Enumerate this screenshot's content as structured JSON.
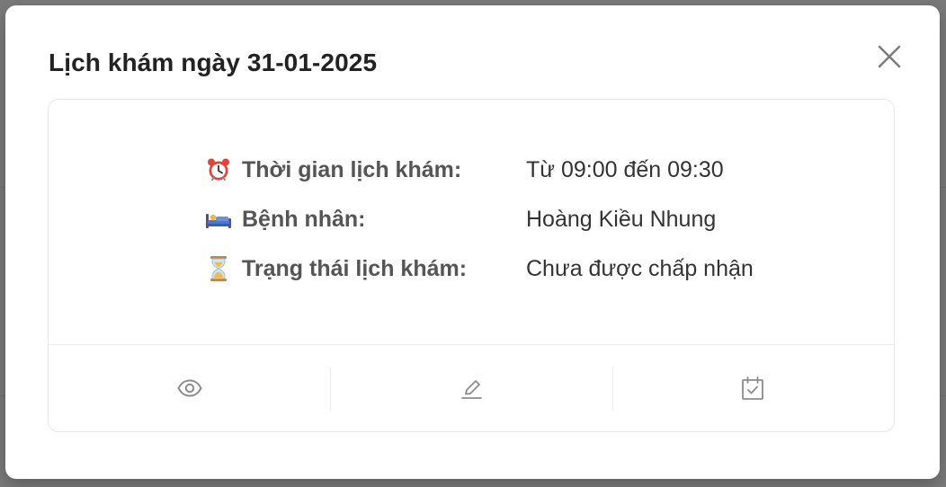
{
  "modal": {
    "title": "Lịch khám ngày 31-01-2025",
    "close_icon": "close-icon"
  },
  "appointment": {
    "rows": [
      {
        "icon": "alarm-clock-icon",
        "label": "Thời gian lịch khám:",
        "value": "Từ 09:00 đến 09:30"
      },
      {
        "icon": "bed-icon",
        "label": "Bệnh nhân:",
        "value": "Hoàng Kiều Nhung"
      },
      {
        "icon": "hourglass-icon",
        "label": "Trạng thái lịch khám:",
        "value": "Chưa được chấp nhận"
      }
    ]
  },
  "actions": [
    {
      "icon": "eye-icon"
    },
    {
      "icon": "edit-icon"
    },
    {
      "icon": "calendar-check-icon"
    }
  ],
  "colors": {
    "backdrop": "#7a7a7a",
    "title_text": "#222222",
    "label_text": "#555555",
    "value_text": "#333333",
    "icon_gray": "#8c8c8c",
    "border": "#e6e6e6"
  }
}
